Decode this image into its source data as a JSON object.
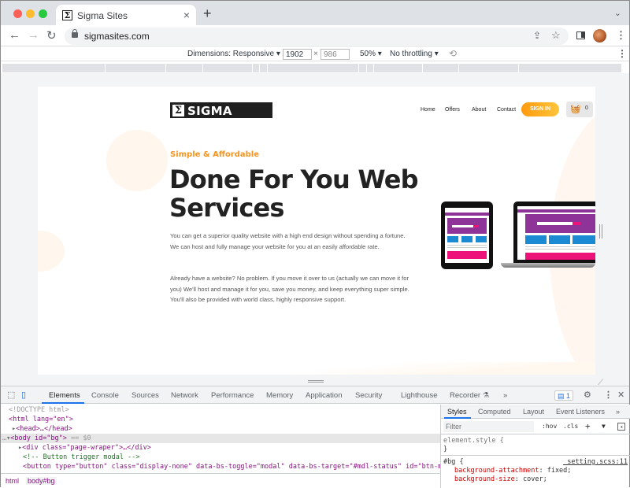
{
  "browser": {
    "tab": {
      "title": "Sigma Sites",
      "favicon": "Σ",
      "close": "×"
    },
    "new_tab": "+",
    "tab_menu": "⌄",
    "nav": {
      "back": "←",
      "forward": "→",
      "reload": "↻"
    },
    "url": "sigmasites.com",
    "icons": {
      "share": "⇪",
      "star": "☆",
      "menu": "⋮"
    }
  },
  "device_toolbar": {
    "dimensions_label": "Dimensions: Responsive ▾",
    "width": "1902",
    "height": "986",
    "times": "×",
    "zoom": "50% ▾",
    "throttling": "No throttling ▾",
    "rotate": "⟲",
    "more": "⋮"
  },
  "site": {
    "logo_symbol": "Σ",
    "logo_text": "SIGMA SITES",
    "nav": [
      "Home",
      "Offers",
      "About",
      "Contact"
    ],
    "signin_label": "SIGN IN",
    "cart_count": "0",
    "kicker": "Simple & Affordable",
    "headline": "Done For You Web Services",
    "para1": "You can get a superior quality website with a high end design without spending a fortune. We can host and fully manage your website for you at an easily affordable rate.",
    "para2": "Already have a website? No problem. If you move it over to us (actually we can move it for you) We'll host and manage it for you, save you money, and keep everything super simple. You'll also be provided with world class, highly responsive support.",
    "colors": {
      "accent": "#f7941d",
      "purple": "#8e3398",
      "blue": "#1b8ad3",
      "pink": "#ec127a"
    }
  },
  "devtools": {
    "tabs": [
      "Elements",
      "Console",
      "Sources",
      "Network",
      "Performance",
      "Memory",
      "Application",
      "Security",
      "Lighthouse",
      "Recorder ⚗"
    ],
    "active_tab": "Elements",
    "more_tabs": "»",
    "issues_count": "1",
    "dom_lines": {
      "doctype": "<!DOCTYPE html>",
      "html_open": "<html lang=\"en\">",
      "head": "<head>…</head>",
      "body_tag": "<body id=\"bg\">",
      "body_suffix": " == $0",
      "div": "<div class=\"page-wraper\">…</div>",
      "comment": "<!-- Button trigger modal -->",
      "button": "<button type=\"button\" class=\"display-none\" data-bs-toggle=\"modal\" data-bs-target=\"#mdl-status\" id=\"btn-moda"
    },
    "breadcrumbs": [
      "html",
      "body#bg"
    ],
    "styles_tabs": [
      "Styles",
      "Computed",
      "Layout",
      "Event Listeners",
      "»"
    ],
    "filter_placeholder": "Filter",
    "filter_buttons": [
      ":hov",
      ".cls",
      "+"
    ],
    "rules": {
      "element_style_open": "element.style {",
      "element_style_close": "}",
      "bg_selector": "#bg {",
      "bg_source": "_setting.scss:11",
      "decl1_prop": "background-attachment",
      "decl1_val": ": fixed;",
      "decl2_prop": "background-size",
      "decl2_val": ": cover;"
    }
  }
}
